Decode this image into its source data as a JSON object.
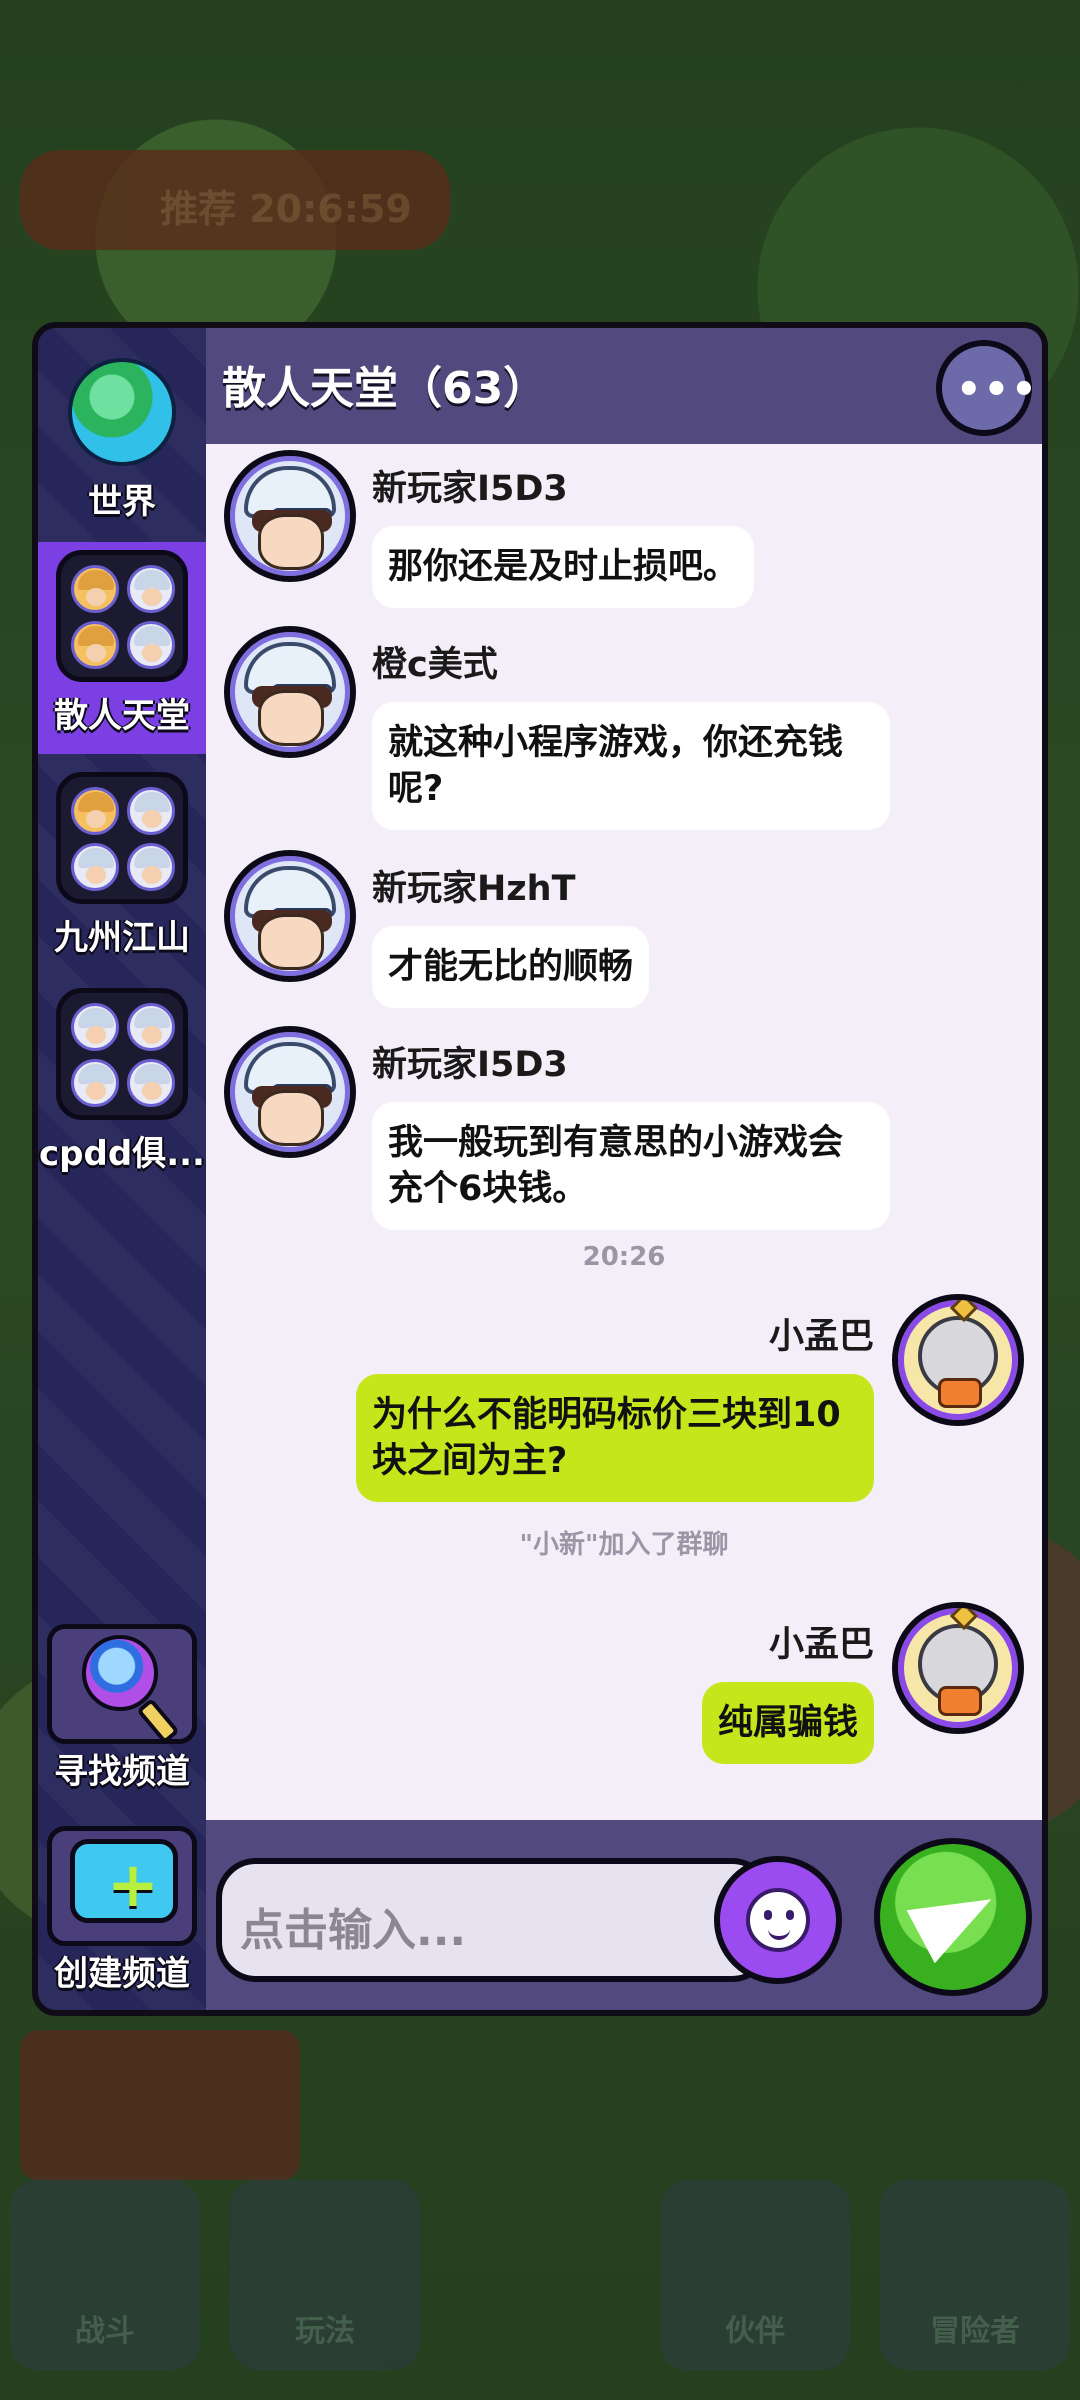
{
  "background": {
    "top_banner_text": "推荐 20:6:59",
    "bottom_labels": [
      "战斗",
      "玩法",
      "",
      "伙伴",
      "冒险者"
    ]
  },
  "sidebar": {
    "world_label": "世界",
    "channels": [
      {
        "label": "散人天堂",
        "active": true
      },
      {
        "label": "九州江山",
        "active": false
      },
      {
        "label": "cpdd俱...",
        "active": false
      }
    ],
    "find_channel_label": "寻找频道",
    "create_channel_label": "创建频道"
  },
  "header": {
    "title": "散人天堂（63）",
    "more_icon": "more-icon"
  },
  "messages": [
    {
      "sender": "新玩家I5D3",
      "text": "那你还是及时止损吧。",
      "mine": false
    },
    {
      "sender": "橙c美式",
      "text": "就这种小程序游戏，你还充钱呢?",
      "mine": false
    },
    {
      "sender": "新玩家HzhT",
      "text": "才能无比的顺畅",
      "mine": false
    },
    {
      "sender": "新玩家I5D3",
      "text": "我一般玩到有意思的小游戏会充个6块钱。",
      "mine": false
    },
    {
      "sender": "小孟巴",
      "text": "为什么不能明码标价三块到10块之间为主?",
      "mine": true
    },
    {
      "sender": "小孟巴",
      "text": "纯属骗钱",
      "mine": true
    }
  ],
  "timestamp": "20:26",
  "system_notice": "\"小新\"加入了群聊",
  "input": {
    "placeholder": "点击输入..."
  },
  "colors": {
    "accent_purple": "#7b3fe4",
    "header_bg": "#524a7e",
    "my_bubble": "#c4e61a",
    "send_button": "#38b020"
  }
}
